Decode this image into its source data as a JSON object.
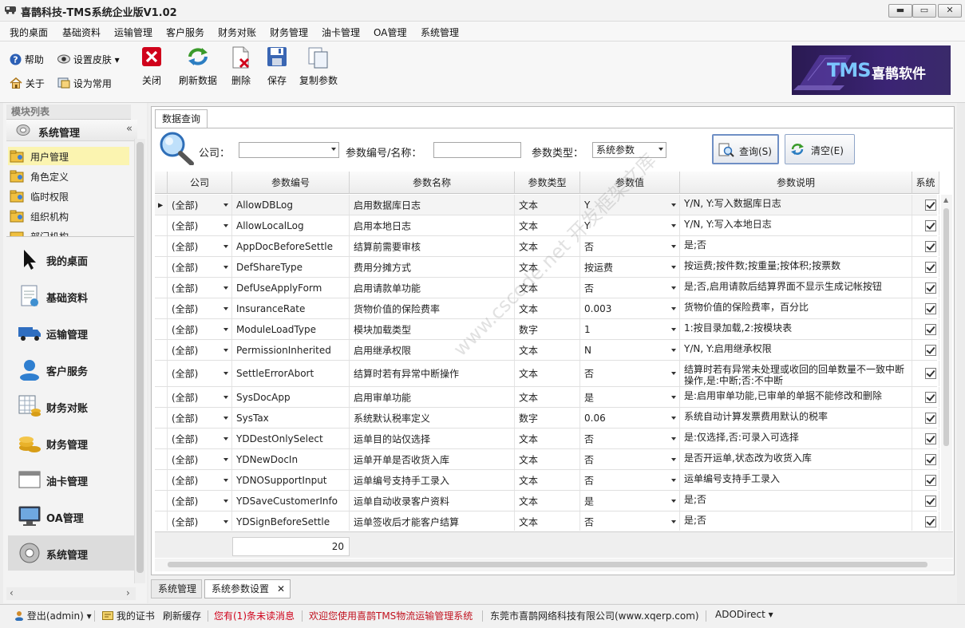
{
  "window": {
    "title": "喜鹊科技-TMS系统企业版V1.02"
  },
  "menu": [
    "我的桌面",
    "基础资料",
    "运输管理",
    "客户服务",
    "财务对账",
    "财务管理",
    "油卡管理",
    "OA管理",
    "系统管理"
  ],
  "toolbar": {
    "help": "帮助",
    "skin": "设置皮肤",
    "about": "关于",
    "favorite": "设为常用",
    "close": "关闭",
    "refresh": "刷新数据",
    "delete": "删除",
    "save": "保存",
    "copy": "复制参数"
  },
  "banner": {
    "tms": "TMS",
    "text": "喜鹊软件"
  },
  "left": {
    "module_list": "模块列表",
    "group": "系统管理",
    "tree": [
      "用户管理",
      "角色定义",
      "临时权限",
      "组织机构",
      "部门机构"
    ],
    "nav": [
      "我的桌面",
      "基础资料",
      "运输管理",
      "客户服务",
      "财务对账",
      "财务管理",
      "油卡管理",
      "OA管理",
      "系统管理"
    ]
  },
  "query": {
    "tab": "数据查询",
    "company_label": "公司：",
    "param_label": "参数编号/名称：",
    "type_label": "参数类型：",
    "type_value": "系统参数",
    "query_btn": "查询(S)",
    "clear_btn": "清空(E)"
  },
  "grid": {
    "headers": [
      "公司",
      "参数编号",
      "参数名称",
      "参数类型",
      "参数值",
      "参数说明",
      "系统"
    ],
    "rows": [
      {
        "company": "(全部)",
        "code": "AllowDBLog",
        "name": "启用数据库日志",
        "type": "文本",
        "value": "Y",
        "desc": "Y/N, Y:写入数据库日志"
      },
      {
        "company": "(全部)",
        "code": "AllowLocalLog",
        "name": "启用本地日志",
        "type": "文本",
        "value": "Y",
        "desc": "Y/N, Y:写入本地日志"
      },
      {
        "company": "(全部)",
        "code": "AppDocBeforeSettle",
        "name": "结算前需要审核",
        "type": "文本",
        "value": "否",
        "desc": "是;否"
      },
      {
        "company": "(全部)",
        "code": "DefShareType",
        "name": "费用分摊方式",
        "type": "文本",
        "value": "按运费",
        "desc": "按运费;按件数;按重量;按体积;按票数"
      },
      {
        "company": "(全部)",
        "code": "DefUseApplyForm",
        "name": "启用请款单功能",
        "type": "文本",
        "value": "否",
        "desc": "是;否,启用请款后结算界面不显示生成记帐按钮"
      },
      {
        "company": "(全部)",
        "code": "InsuranceRate",
        "name": "货物价值的保险费率",
        "type": "文本",
        "value": "0.003",
        "desc": "货物价值的保险费率，百分比"
      },
      {
        "company": "(全部)",
        "code": "ModuleLoadType",
        "name": "模块加载类型",
        "type": "数字",
        "value": "1",
        "desc": "1:按目录加载,2:按模块表"
      },
      {
        "company": "(全部)",
        "code": "PermissionInherited",
        "name": "启用继承权限",
        "type": "文本",
        "value": "N",
        "desc": "Y/N, Y:启用继承权限"
      },
      {
        "company": "(全部)",
        "code": "SettleErrorAbort",
        "name": "结算时若有异常中断操作",
        "type": "文本",
        "value": "否",
        "desc": "结算时若有异常未处理或收回的回单数量不一致中断操作,是:中断;否:不中断"
      },
      {
        "company": "(全部)",
        "code": "SysDocApp",
        "name": "启用审单功能",
        "type": "文本",
        "value": "是",
        "desc": "是:启用审单功能,已审单的单据不能修改和删除"
      },
      {
        "company": "(全部)",
        "code": "SysTax",
        "name": "系统默认税率定义",
        "type": "数字",
        "value": "0.06",
        "desc": "系统自动计算发票费用默认的税率"
      },
      {
        "company": "(全部)",
        "code": "YDDestOnlySelect",
        "name": "运单目的站仅选择",
        "type": "文本",
        "value": "否",
        "desc": "是:仅选择,否:可录入可选择"
      },
      {
        "company": "(全部)",
        "code": "YDNewDocIn",
        "name": "运单开单是否收货入库",
        "type": "文本",
        "value": "否",
        "desc": "是否开运单,状态改为收货入库"
      },
      {
        "company": "(全部)",
        "code": "YDNOSupportInput",
        "name": "运单编号支持手工录入",
        "type": "文本",
        "value": "否",
        "desc": "运单编号支持手工录入"
      },
      {
        "company": "(全部)",
        "code": "YDSaveCustomerInfo",
        "name": "运单自动收录客户资料",
        "type": "文本",
        "value": "是",
        "desc": "是;否"
      },
      {
        "company": "(全部)",
        "code": "YDSignBeforeSettle",
        "name": "运单签收后才能客户结算",
        "type": "文本",
        "value": "否",
        "desc": "是;否"
      }
    ],
    "count": "20"
  },
  "bottom_tabs": [
    "系统管理",
    "系统参数设置"
  ],
  "status": {
    "login": "登出(admin)",
    "cert": "我的证书",
    "refresh_cache": "刷新缓存",
    "unread": "您有(1)条未读消息",
    "welcome": "欢迎您使用喜鹊TMS物流运输管理系统",
    "company": "东莞市喜鹊网络科技有限公司(www.xqerp.com)",
    "ado": "ADODirect"
  },
  "watermark": "www.cscode.net 开发框架文库",
  "colors": {
    "accent_red": "#d0021b",
    "welcome_red": "#c1121f",
    "selected_tree": "#fbf4b0",
    "banner_bg": "#3b2474"
  }
}
